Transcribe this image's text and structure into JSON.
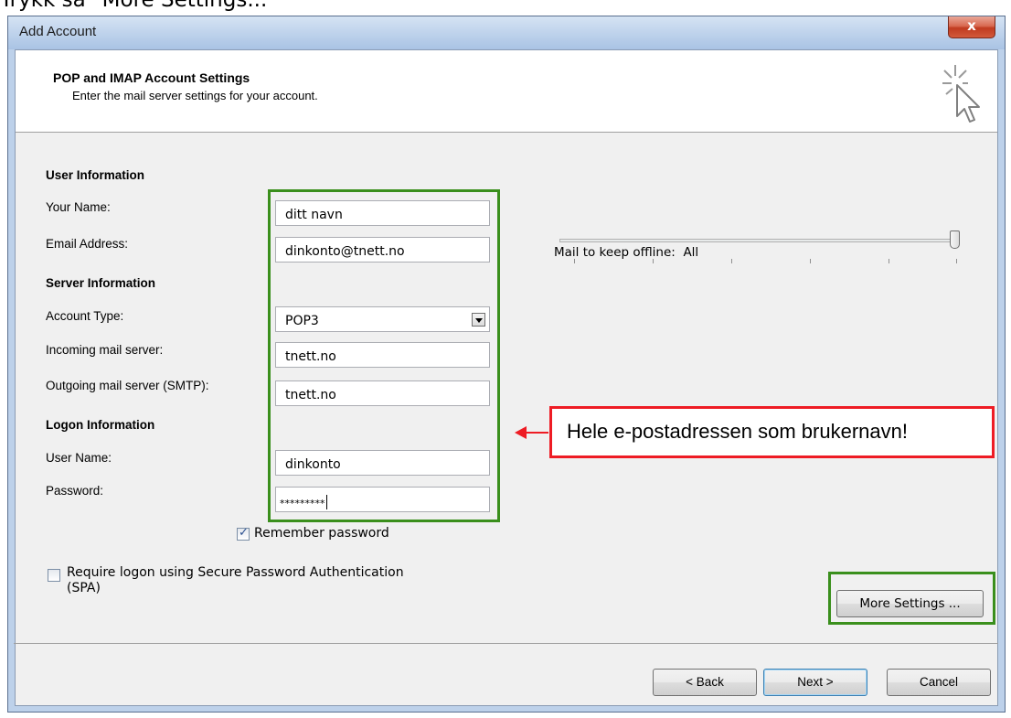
{
  "caption": "Trykk så \"More Settings...\"",
  "window": {
    "title": "Add Account",
    "close_label": "x"
  },
  "header": {
    "title": "POP and IMAP Account Settings",
    "subtitle": "Enter the mail server settings for your account."
  },
  "user_info": {
    "section_label": "User Information",
    "your_name_label": "Your Name:",
    "your_name_value": "ditt navn",
    "email_label": "Email Address:",
    "email_value": "dinkonto@tnett.no"
  },
  "server_info": {
    "section_label": "Server Information",
    "account_type_label": "Account Type:",
    "account_type_value": "POP3",
    "incoming_label": "Incoming mail server:",
    "incoming_value": "tnett.no",
    "outgoing_label": "Outgoing mail server (SMTP):",
    "outgoing_value": "tnett.no"
  },
  "logon_info": {
    "section_label": "Logon Information",
    "username_label": "User Name:",
    "username_value": "dinkonto",
    "password_label": "Password:",
    "password_value": "*********",
    "remember_label": "Remember password",
    "remember_checked": true,
    "spa_label_line1": "Require logon using Secure Password Authentication",
    "spa_label_line2": "(SPA)",
    "spa_checked": false
  },
  "offline": {
    "label": "Mail to keep offline:",
    "value": "All",
    "slider_position": 1.0
  },
  "annotation": {
    "text": "Hele e-postadressen som brukernavn!",
    "color": "#ee1c24",
    "highlight_color": "#3a8f1c"
  },
  "buttons": {
    "more_settings": "More Settings ...",
    "back": "< Back",
    "next": "Next >",
    "cancel": "Cancel"
  }
}
